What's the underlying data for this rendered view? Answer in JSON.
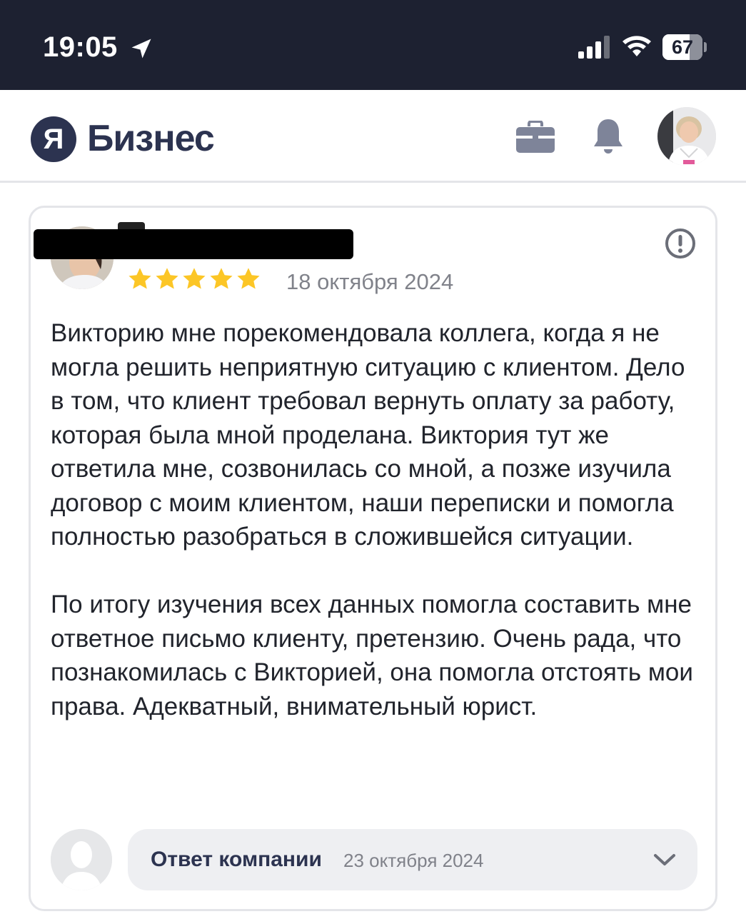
{
  "status_bar": {
    "time": "19:05",
    "battery_percent": 67,
    "battery_label": "67",
    "icons": [
      "location-arrow-icon",
      "signal-icon",
      "wifi-icon",
      "battery-icon"
    ]
  },
  "header": {
    "logo_letter": "Я",
    "logo_text": "Бизнес",
    "icons": [
      "briefcase-icon",
      "bell-icon",
      "user-avatar"
    ]
  },
  "review": {
    "rating": 5,
    "rating_max": 5,
    "date": "18 октября 2024",
    "paragraph_1": "Викторию мне порекомендовала коллега, когда я не могла решить неприятную ситуацию с клиентом. Дело в том, что клиент требовал вернуть оплату за работу, которая была мной проделана. Виктория тут же ответила мне, созвонилась со мной, а позже изучила договор с моим клиентом, наши переписки и помогла полностью разобраться в сложившейся ситуации.",
    "paragraph_2": "По итогу изучения всех данных помогла составить мне ответное письмо клиенту, претензию. Очень рада, что познакомилась с Викторией, она помогла отстоять мои права. Адекватный, внимательный юрист.",
    "star_color": "#fcc626",
    "report_icon": "exclamation-circle-icon"
  },
  "company_reply": {
    "label": "Ответ компании",
    "date": "23 октября 2024",
    "icon": "chevron-down-icon"
  },
  "colors": {
    "status_bar_bg": "#1d2131",
    "brand": "#2c3350",
    "muted_text": "#80828a",
    "border": "#e4e5e9"
  }
}
